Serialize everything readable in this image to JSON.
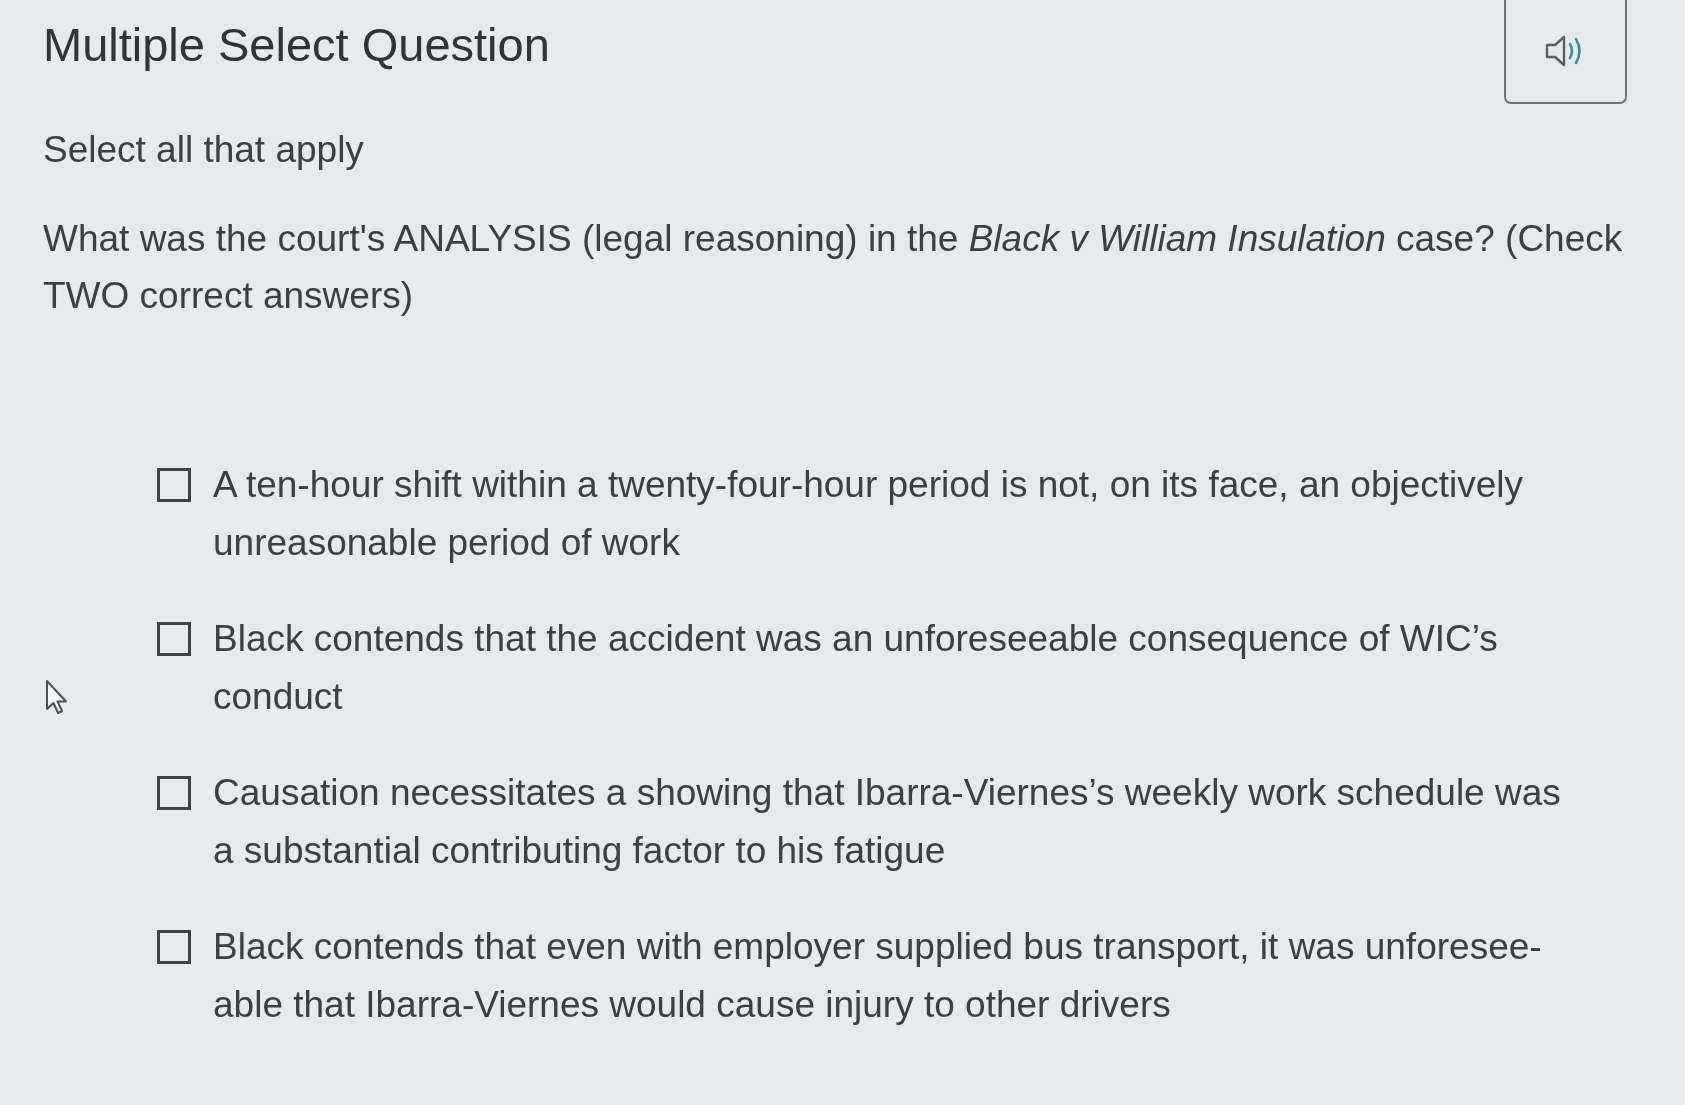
{
  "header": {
    "title": "Multiple Select Question"
  },
  "instruction": "Select all that apply",
  "question": "What was the court's ANALYSIS (legal reasoning) in the *Black v William Insulation* case? (Check TWO correct answers)",
  "options": [
    {
      "text": "A ten-hour shift within a twenty-four-hour period is not, on its face, an objectively unreasonable period of work",
      "checked": false
    },
    {
      "text": "Black contends that the accident was an unforeseeable consequence of WIC’s conduct",
      "checked": false
    },
    {
      "text": "Causation necessitates a showing that Ibarra-Viernes’s weekly work schedule was a substantial contributing factor to his fatigue",
      "checked": false
    },
    {
      "text": "Black contends that even with employer supplied bus transport, it was unforesee-able that Ibarra-Viernes would cause injury to other drivers",
      "checked": false
    }
  ]
}
